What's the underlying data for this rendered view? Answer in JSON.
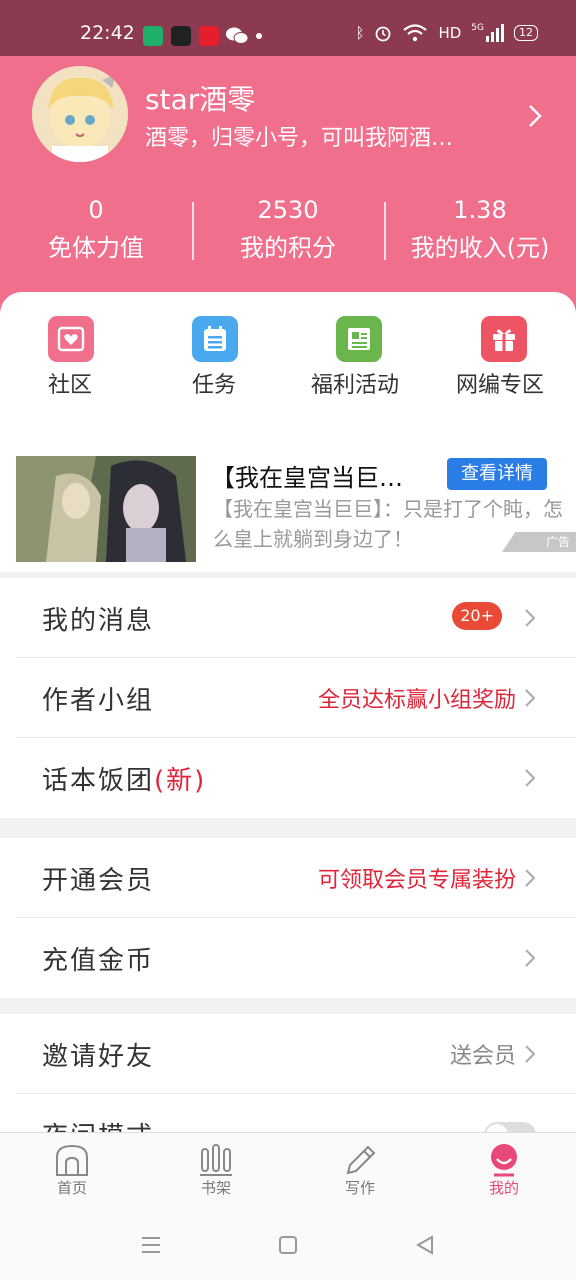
{
  "status_bar": {
    "time": "22:42",
    "network": "HD",
    "signal_label": "5G",
    "battery": "12"
  },
  "profile": {
    "username": "star酒零",
    "signature": "酒零，归零小号，可叫我阿酒…",
    "stats": [
      {
        "value": "0",
        "label": "免体力值"
      },
      {
        "value": "2530",
        "label": "我的积分"
      },
      {
        "value": "1.38",
        "label": "我的收入(元)"
      }
    ]
  },
  "features": [
    {
      "label": "社区",
      "icon": "community-icon",
      "color": "#ef6f8c"
    },
    {
      "label": "任务",
      "icon": "task-icon",
      "color": "#4aa8ef"
    },
    {
      "label": "福利活动",
      "icon": "welfare-icon",
      "color": "#6ab64c"
    },
    {
      "label": "网编专区",
      "icon": "gift-icon",
      "color": "#ee5564"
    }
  ],
  "ad": {
    "title": "【我在皇宫当巨…",
    "button": "查看详情",
    "description": "【我在皇宫当巨巨】：只是打了个盹，怎么皇上就躺到身边了！",
    "tag": "广告"
  },
  "menu": {
    "messages": {
      "label": "我的消息",
      "badge": "20+"
    },
    "author_group": {
      "label": "作者小组",
      "value": "全员达标赢小组奖励"
    },
    "story_group": {
      "label": "话本饭团",
      "new": "(新)"
    },
    "membership": {
      "label": "开通会员",
      "value": "可领取会员专属装扮"
    },
    "recharge": {
      "label": "充值金币"
    },
    "invite": {
      "label": "邀请好友",
      "value": "送会员"
    },
    "night_mode": {
      "label": "夜间模式"
    }
  },
  "tabs": [
    {
      "label": "首页"
    },
    {
      "label": "书架"
    },
    {
      "label": "写作"
    },
    {
      "label": "我的"
    }
  ],
  "colors": {
    "brand": "#ef6f8c",
    "status_bar": "#8b3a50",
    "accent_red": "#e0253a",
    "active_tab": "#e8487a"
  }
}
